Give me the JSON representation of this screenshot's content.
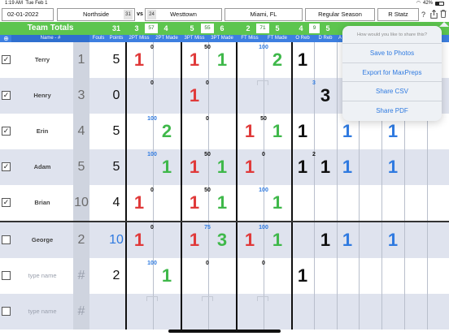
{
  "status": {
    "time": "1:19 AM",
    "date": "Tue Feb 1",
    "battery": "42%"
  },
  "header": {
    "game_date": "02-01-2022",
    "home_team": "Northside",
    "home_score": "31",
    "vs": "vs",
    "away_score": "24",
    "away_team": "Westtown",
    "location": "Miami, FL",
    "season": "Regular Season",
    "stats_button": "R Statz",
    "help_icon": "?"
  },
  "team_totals": {
    "title": "Team Totals",
    "points": "31",
    "two_pt_miss": "3",
    "two_pt_pct": "57",
    "two_pt_made": "4",
    "three_pt_miss": "5",
    "three_pt_pct": "55",
    "three_pt_made": "6",
    "ft_miss": "2",
    "ft_pct": "71",
    "ft_made": "5",
    "o_reb": "4",
    "d_reb_pct": "9",
    "d_reb": "5"
  },
  "columns": {
    "name": "Name - #",
    "fouls": "Fouls",
    "points": "Points",
    "two_miss": "2PT Miss",
    "two_made": "2PT Made",
    "three_miss": "3PT Miss",
    "three_made": "3PT Made",
    "ft_miss": "FT Miss",
    "ft_made": "FT Made",
    "o_reb": "O Reb",
    "d_reb": "D Reb",
    "extra": "A"
  },
  "players": [
    {
      "name": "Terry",
      "number": "1",
      "checked": "✓",
      "points": "5",
      "two_pct": "0",
      "two_miss": "1",
      "two_made": "",
      "three_pct": "50",
      "three_miss": "1",
      "three_made": "1",
      "ft_pct": "100",
      "ft_miss": "",
      "ft_made": "2",
      "oreb_pct": "",
      "o_reb": "1",
      "d_reb": "",
      "ast1": "",
      "ast2": ""
    },
    {
      "name": "Henry",
      "number": "3",
      "checked": "✓",
      "points": "0",
      "two_pct": "0",
      "two_miss": "",
      "two_made": "",
      "three_pct": "0",
      "three_miss": "1",
      "three_made": "",
      "ft_pct": "",
      "ft_miss": "",
      "ft_made": "",
      "oreb_pct": "3",
      "o_reb": "",
      "d_reb": "3",
      "ast1": "",
      "ast2": ""
    },
    {
      "name": "Erin",
      "number": "4",
      "checked": "✓",
      "points": "5",
      "two_pct": "100",
      "two_miss": "",
      "two_made": "2",
      "three_pct": "0",
      "three_miss": "",
      "three_made": "",
      "ft_pct": "50",
      "ft_miss": "1",
      "ft_made": "1",
      "oreb_pct": "",
      "o_reb": "1",
      "d_reb": "",
      "ast1": "1",
      "ast2": "1"
    },
    {
      "name": "Adam",
      "number": "5",
      "checked": "✓",
      "points": "5",
      "two_pct": "100",
      "two_miss": "",
      "two_made": "1",
      "three_pct": "50",
      "three_miss": "1",
      "three_made": "1",
      "ft_pct": "0",
      "ft_miss": "1",
      "ft_made": "",
      "oreb_pct": "2",
      "o_reb": "1",
      "d_reb": "1",
      "ast1": "1",
      "ast2": "1"
    },
    {
      "name": "Brian",
      "number": "10",
      "checked": "✓",
      "points": "4",
      "two_pct": "0",
      "two_miss": "1",
      "two_made": "",
      "three_pct": "50",
      "three_miss": "1",
      "three_made": "1",
      "ft_pct": "100",
      "ft_miss": "",
      "ft_made": "1",
      "oreb_pct": "",
      "o_reb": "",
      "d_reb": "",
      "ast1": "",
      "ast2": ""
    },
    {
      "name": "George",
      "number": "2",
      "checked": "",
      "points": "10",
      "two_pct": "0",
      "two_miss": "1",
      "two_made": "",
      "three_pct": "75",
      "three_miss": "1",
      "three_made": "3",
      "ft_pct": "100",
      "ft_miss": "1",
      "ft_made": "1",
      "oreb_pct": "",
      "o_reb": "",
      "d_reb": "1",
      "ast1": "1",
      "ast2": "1"
    },
    {
      "name": "type name",
      "number": "#",
      "checked": "",
      "points": "2",
      "two_pct": "100",
      "two_miss": "",
      "two_made": "1",
      "three_pct": "0",
      "three_miss": "",
      "three_made": "",
      "ft_pct": "0",
      "ft_miss": "",
      "ft_made": "",
      "oreb_pct": "",
      "o_reb": "1",
      "d_reb": "",
      "ast1": "",
      "ast2": ""
    },
    {
      "name": "type name",
      "number": "#",
      "checked": "",
      "points": "",
      "two_pct": "",
      "two_miss": "",
      "two_made": "",
      "three_pct": "",
      "three_miss": "",
      "three_made": "",
      "ft_pct": "",
      "ft_miss": "",
      "ft_made": "",
      "oreb_pct": "",
      "o_reb": "",
      "d_reb": "",
      "ast1": "",
      "ast2": ""
    }
  ],
  "share_menu": {
    "title": "How would you like to share this?",
    "items": [
      "Save to Photos",
      "Export for MaxPreps",
      "Share CSV",
      "Share PDF"
    ]
  },
  "colors": {
    "team_totals_green": "#5dc54f",
    "header_blue": "#3d7fe0",
    "miss_red": "#e03a3a",
    "made_green": "#3fb84a",
    "assist_blue": "#2f7ae0"
  }
}
